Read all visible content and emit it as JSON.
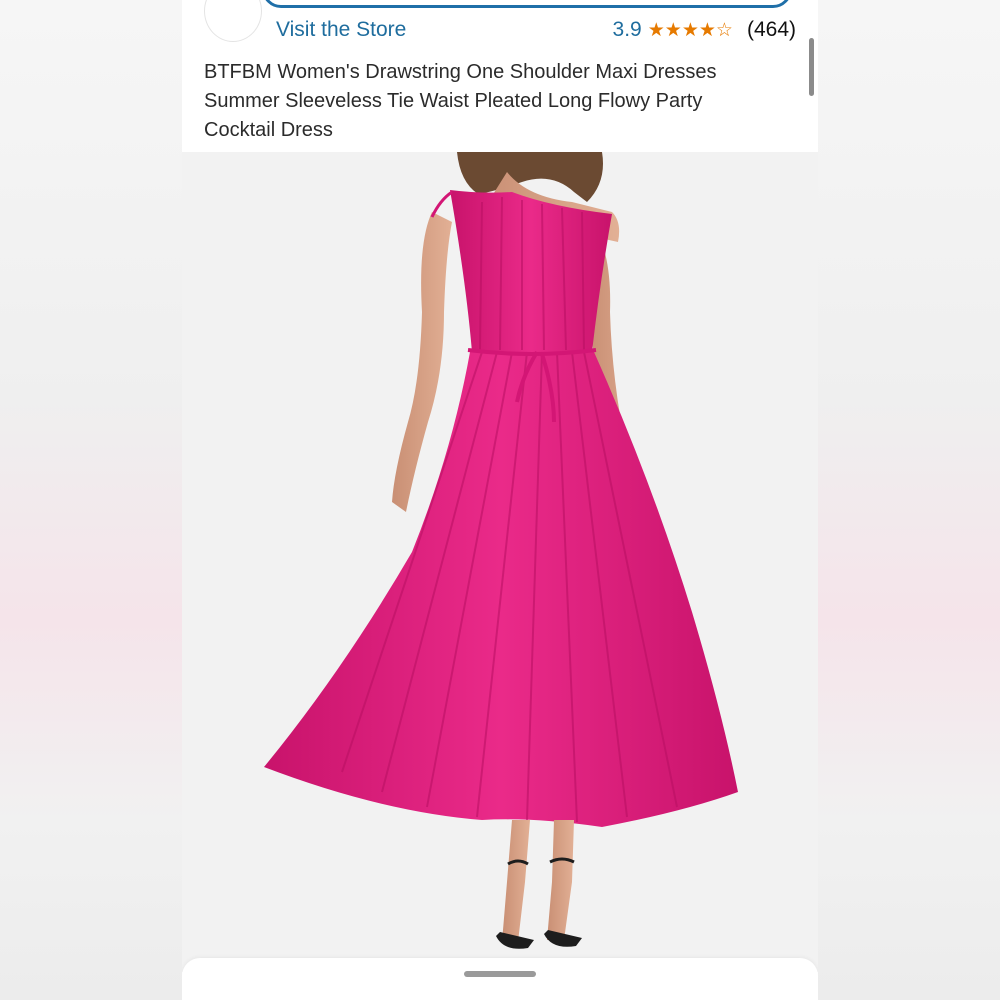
{
  "header": {
    "visit_store": "Visit the Store",
    "rating_value": "3.9",
    "rating_stars": 3.9,
    "review_count": "(464)"
  },
  "product": {
    "title": "BTFBM Women's Drawstring One Shoulder Maxi Dresses Summer Sleeveless Tie Waist Pleated Long Flowy Party Cocktail Dress"
  },
  "icons": {
    "star_full": "star-icon",
    "star_empty": "star-outline-icon"
  },
  "colors": {
    "link": "#1f6d9e",
    "star": "#e67a00",
    "dress": "#e21b7d"
  }
}
